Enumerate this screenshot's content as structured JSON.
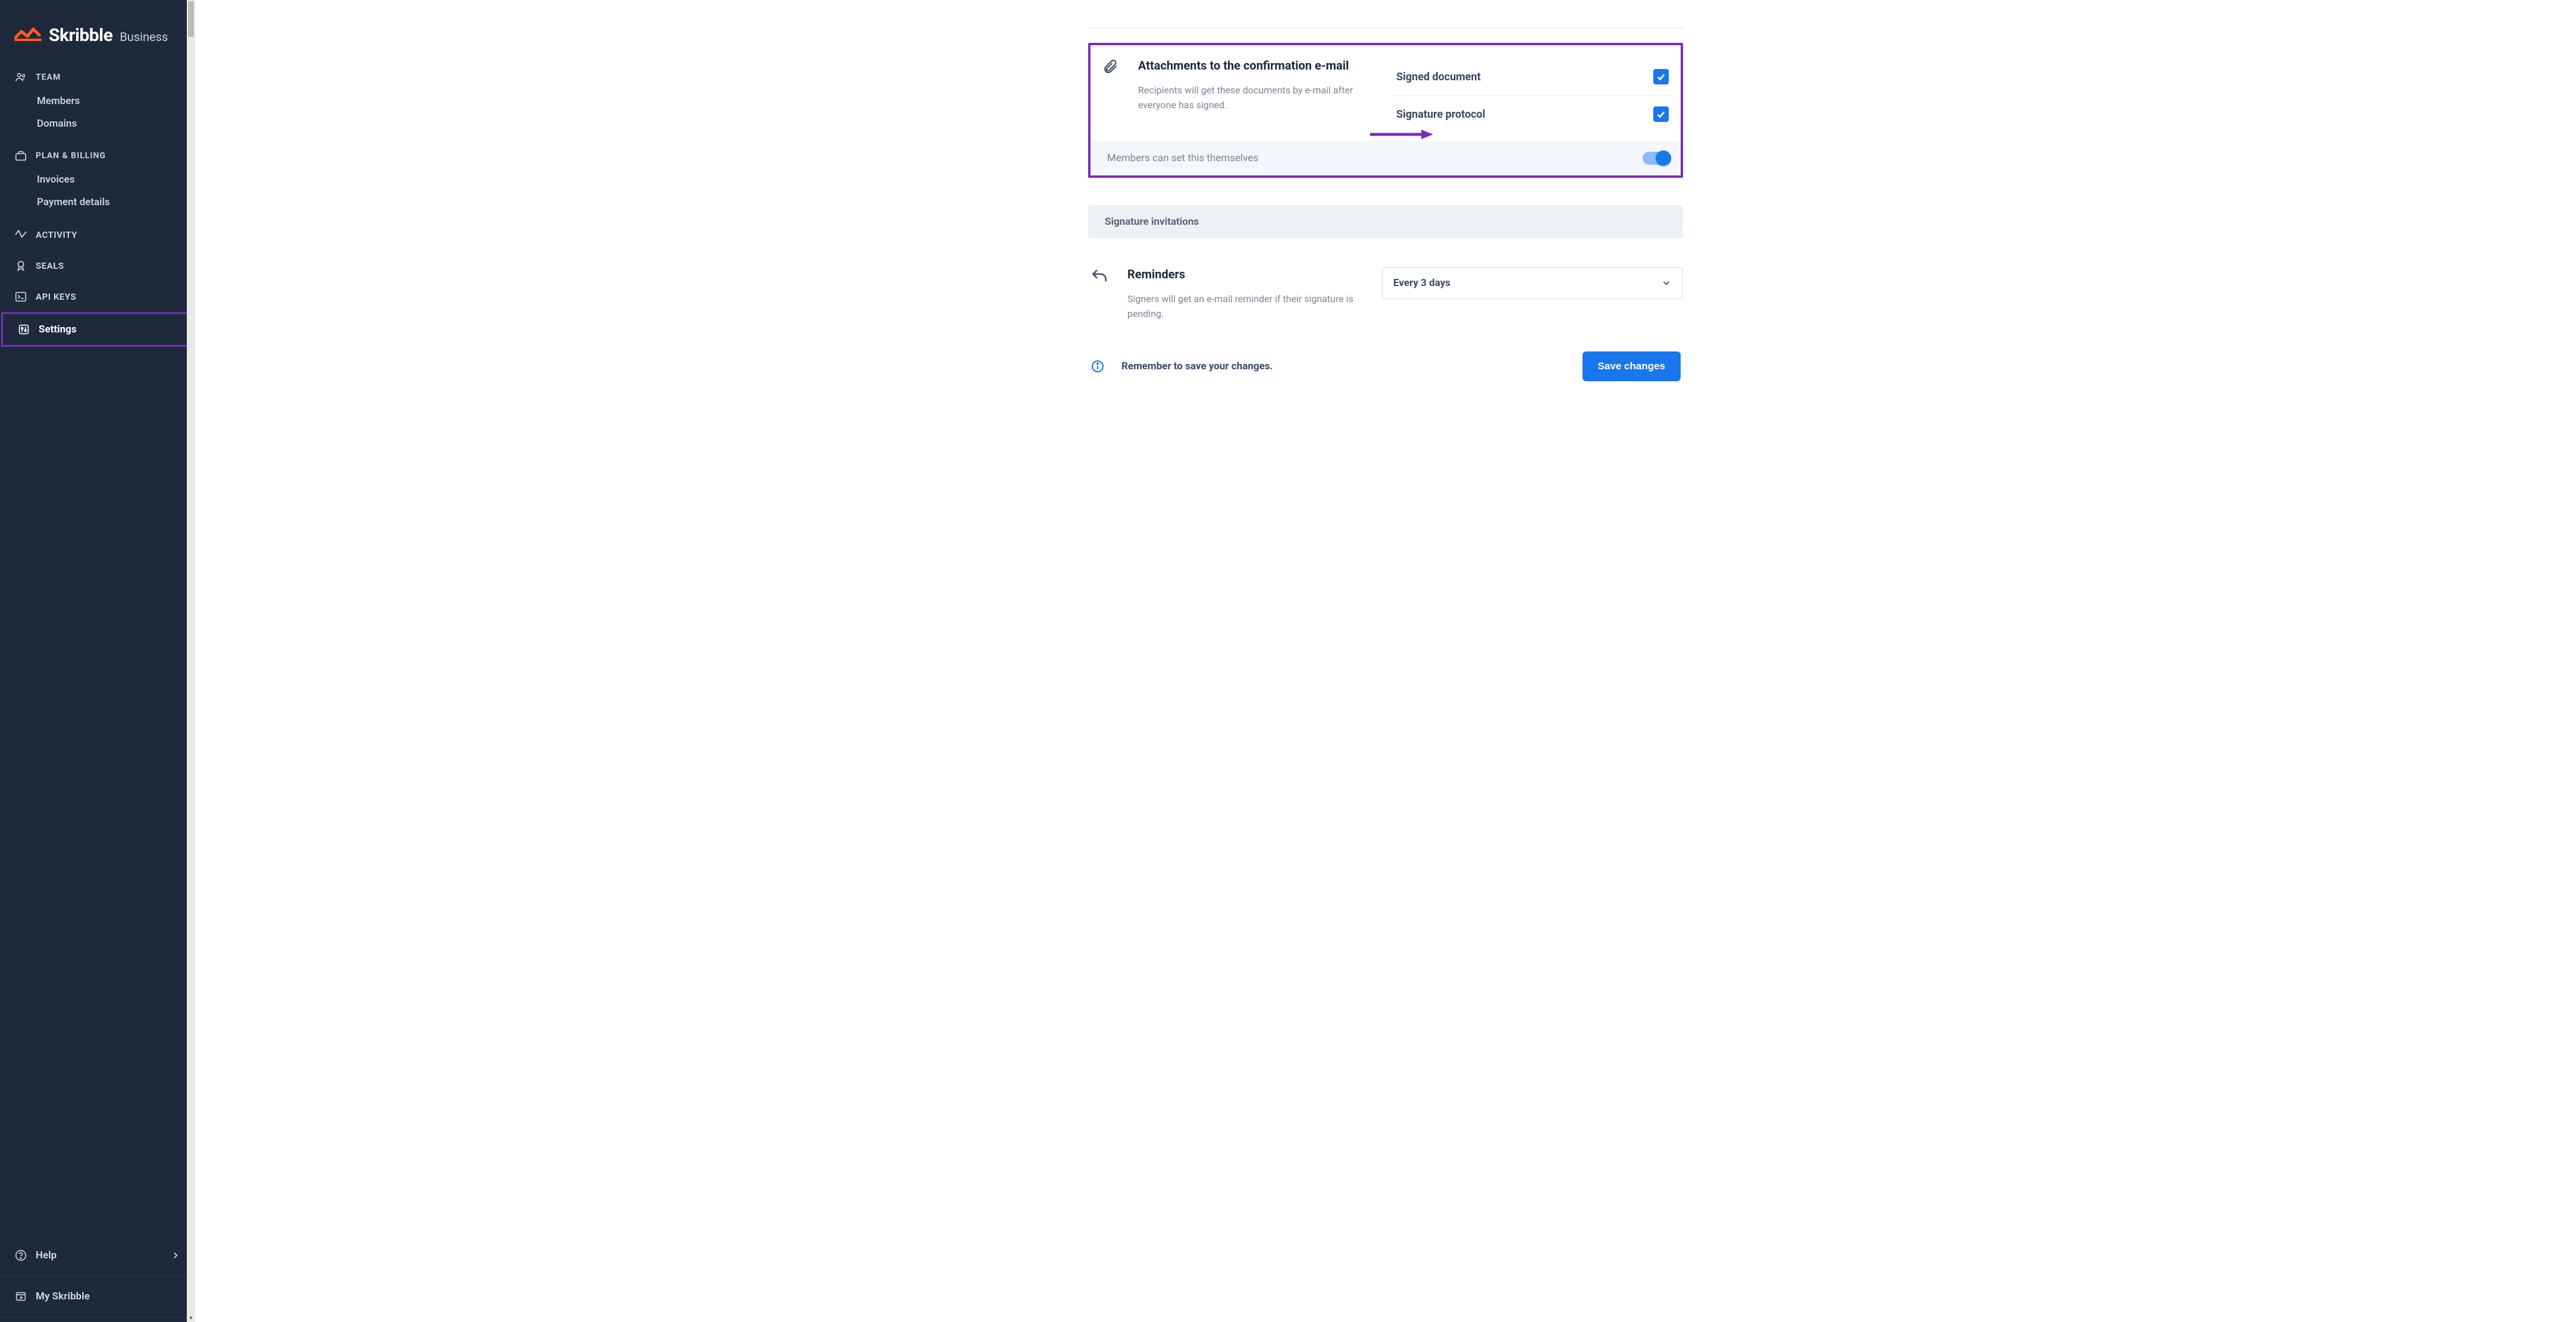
{
  "brand": {
    "name": "Skribble",
    "suffix": "Business"
  },
  "sidebar": {
    "groups": [
      {
        "label": "TEAM",
        "items": [
          {
            "label": "Members"
          },
          {
            "label": "Domains"
          }
        ]
      },
      {
        "label": "PLAN & BILLING",
        "items": [
          {
            "label": "Invoices"
          },
          {
            "label": "Payment details"
          }
        ]
      }
    ],
    "single_items": {
      "activity": "ACTIVITY",
      "seals": "SEALS",
      "api_keys": "API KEYS",
      "settings": "Settings",
      "help": "Help",
      "my_skribble": "My Skribble"
    }
  },
  "attachments": {
    "title": "Attachments to the confirmation e-mail",
    "desc": "Recipients will get these documents by e-mail after everyone has signed.",
    "options": [
      {
        "label": "Signed document",
        "checked": true
      },
      {
        "label": "Signature protocol",
        "checked": true
      }
    ],
    "member_toggle_label": "Members can set this themselves",
    "member_toggle_on": true
  },
  "signature_invitations": {
    "header": "Signature invitations"
  },
  "reminders": {
    "title": "Reminders",
    "desc": "Signers will get an e-mail reminder if their signature is pending.",
    "selected": "Every 3 days"
  },
  "footer": {
    "reminder": "Remember to save your changes.",
    "save": "Save changes"
  },
  "colors": {
    "accent": "#1976ed",
    "highlight": "#7b2cbf",
    "sidebar_bg": "#1e2a3b",
    "brand_orange": "#ff5a1f"
  }
}
